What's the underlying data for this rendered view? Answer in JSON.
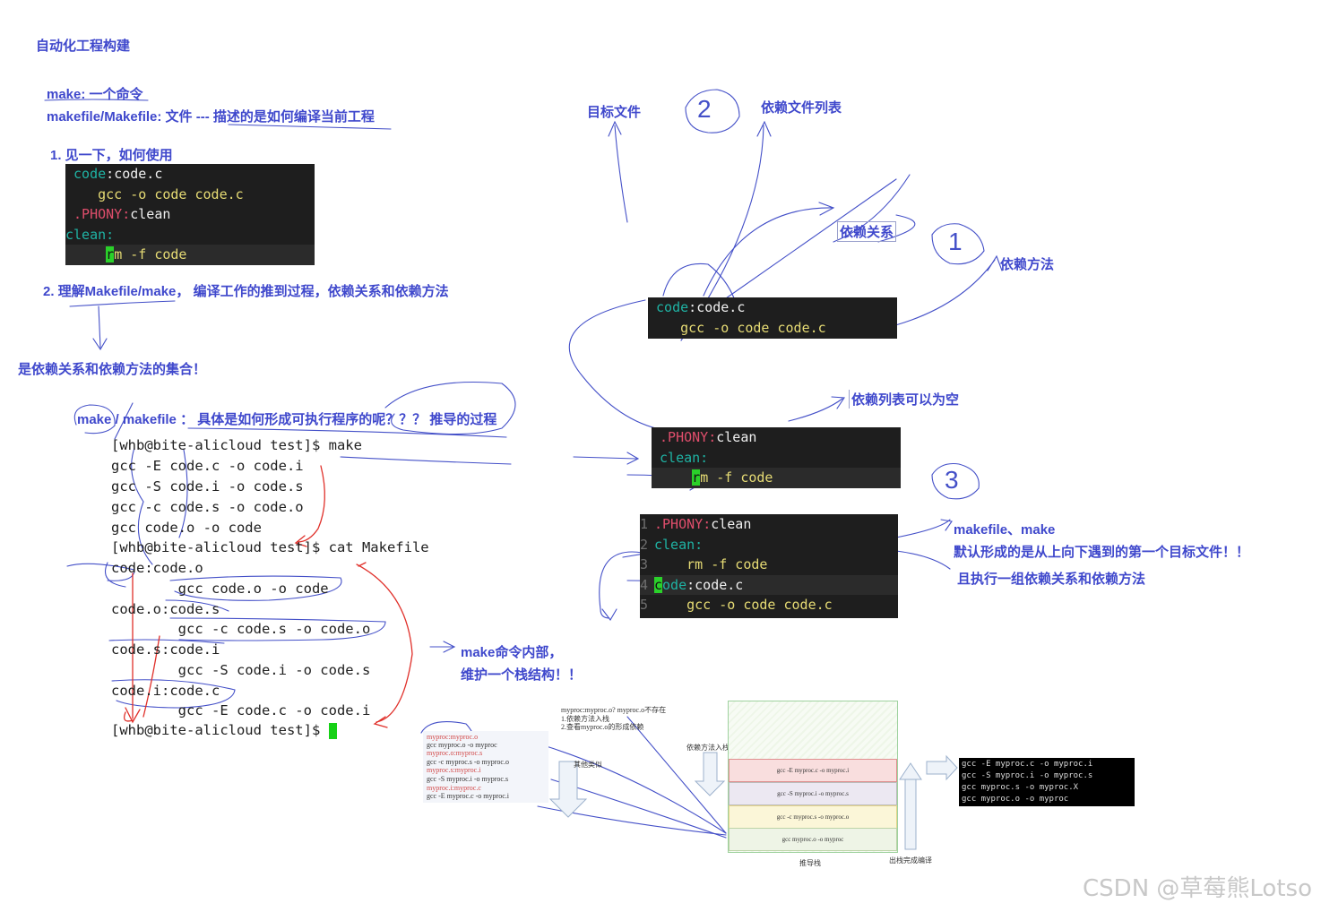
{
  "title": "自动化工程构建",
  "intro": {
    "make_line": "make: 一个命令",
    "makefile_line": "makefile/Makefile: 文件 --- 描述的是如何编译当前工程"
  },
  "section1": "1. 见一下，如何使用",
  "section2": "2. 理解Makefile/make， 编译工作的推到过程，依赖关系和依赖方法",
  "collection_note": "是依赖关系和依赖方法的集合！",
  "question": "make / makefile ： 具体是如何形成可执行程序的呢？？？ 推导的过程",
  "code_block1": {
    "r1_target": "code",
    "r1_colon": ":",
    "r1_dep": "code.c",
    "r2": "    gcc -o code code.c",
    "r3_target": ".PHONY",
    "r3_colon": ":",
    "r3_dep": "clean",
    "r4": "clean:",
    "r5_cursor": "r",
    "r5_rest": "m -f code"
  },
  "terminal": [
    "[whb@bite-alicloud test]$ make",
    "gcc -E code.c -o code.i",
    "gcc -S code.i -o code.s",
    "gcc -c code.s -o code.o",
    "gcc code.o -o code",
    "[whb@bite-alicloud test]$ cat Makefile",
    "code:code.o",
    "        gcc code.o -o code",
    "code.o:code.s",
    "        gcc -c code.s -o code.o",
    "code.s:code.i",
    "        gcc -S code.i -o code.s",
    "code.i:code.c",
    "        gcc -E code.c -o code.i",
    "[whb@bite-alicloud test]$ "
  ],
  "labels": {
    "target_file": "目标文件",
    "dep_list": "依赖文件列表",
    "dep_relation": "依赖关系",
    "dep_method": "依赖方法",
    "dep_list_empty": "依赖列表可以为空",
    "circle1": "1",
    "circle2": "2",
    "circle3": "3",
    "make_stack1": "make命令内部，",
    "make_stack2": "维护一个栈结构！！",
    "default1": "makefile、make",
    "default2": "默认形成的是从上向下遇到的第一个目标文件！！",
    "default3": "且执行一组依赖关系和依赖方法"
  },
  "code_block2": {
    "r1_target": "code",
    "r1_colon": ":",
    "r1_dep": "code.c",
    "r2": "    gcc -o code code.c"
  },
  "code_block3": {
    "r1_target": ".PHONY",
    "r1_colon": ":",
    "r1_dep": "clean",
    "r2": "clean:",
    "r3_cursor": "r",
    "r3_rest": "m -f code"
  },
  "code_block4": {
    "lines": [
      "1",
      "2",
      "3",
      "4",
      "5"
    ],
    "r1_target": ".PHONY",
    "r1_colon": ":",
    "r1_dep": "clean",
    "r2": "clean:",
    "r3": "    rm -f code",
    "r4_cursor": "c",
    "r4_rest": "ode",
    "r4_colon": ":",
    "r4_dep": "code.c",
    "r5": "    gcc -o code code.c"
  },
  "mini": {
    "makefile_lines": [
      "myproc:myproc.o",
      "      gcc myproc.o -o myproc",
      "myproc.o:myproc.s",
      "      gcc -c myproc.s -o myproc.o",
      "myproc.s:myproc.i",
      "      gcc -S myproc.i -o myproc.s",
      "myproc.i:myproc.c",
      "      gcc -E myproc.c -o myproc.i"
    ],
    "note_top": "myproc:myproc.o?  myproc.o不存在",
    "note_1": "1.依赖方法入栈",
    "note_2": "2.查看myproc.o的形成依赖",
    "recursion": "其他类似",
    "push_label": "依赖方法入栈",
    "stack_items": [
      "gcc -E myproc.c -o myproc.i",
      "gcc -S myproc.i -o myproc.s",
      "gcc -c myproc.s -o myproc.o",
      "gcc myproc.o -o myproc"
    ],
    "stack_name": "推导栈",
    "pop_label": "出栈完成编译",
    "output_lines": [
      "gcc -E myproc.c -o myproc.i",
      "gcc -S myproc.i -o myproc.s",
      "gcc myproc.s -o myproc.X",
      "gcc myproc.o -o myproc"
    ]
  },
  "watermark": "CSDN @草莓熊Lotso"
}
